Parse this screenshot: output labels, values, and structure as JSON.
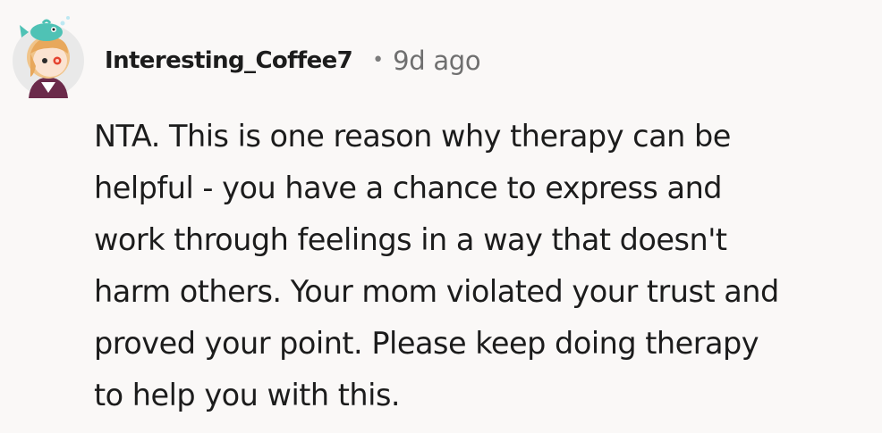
{
  "comment": {
    "author": "Interesting_Coffee7",
    "separator": "•",
    "timestamp": "9d ago",
    "avatar_icon": "user-avatar-icon",
    "body_lines": [
      "NTA. This is one reason why therapy can be",
      "helpful - you have a chance to express and",
      "work through feelings in a way that doesn't",
      "harm others. Your mom violated your trust and",
      "proved your point. Please keep doing therapy",
      "to help you with this."
    ]
  },
  "colors": {
    "background": "#faf8f7",
    "text": "#1c1c1c",
    "meta": "#6f6f6f"
  }
}
